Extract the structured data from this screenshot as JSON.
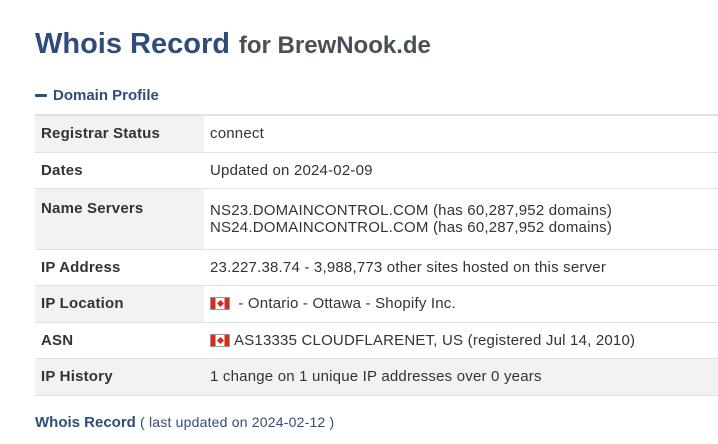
{
  "header": {
    "title": "Whois Record",
    "subtitle": "for BrewNook.de"
  },
  "section": {
    "label": "Domain Profile",
    "icon": "minus-icon"
  },
  "profile": {
    "registrar_status": {
      "label": "Registrar Status",
      "value": "connect"
    },
    "dates": {
      "label": "Dates",
      "value": "Updated on 2024-02-09"
    },
    "name_servers": {
      "label": "Name Servers",
      "values": [
        "NS23.DOMAINCONTROL.COM (has 60,287,952 domains)",
        "NS24.DOMAINCONTROL.COM (has 60,287,952 domains)"
      ]
    },
    "ip_address": {
      "label": "IP Address",
      "value": "23.227.38.74 - 3,988,773 other sites hosted on this server"
    },
    "ip_location": {
      "label": "IP Location",
      "value": " - Ontario - Ottawa - Shopify Inc.",
      "flag": "canada-flag-icon"
    },
    "asn": {
      "label": "ASN",
      "value": "AS13335 CLOUDFLARENET, US (registered Jul 14, 2010)",
      "flag": "canada-flag-icon"
    },
    "ip_history": {
      "label": "IP History",
      "value": "1 change on 1 unique IP addresses over 0 years"
    }
  },
  "footer": {
    "link": "Whois Record",
    "note": "( last updated on 2024-02-12 )"
  },
  "colors": {
    "brand": "#2f4d7a",
    "row_shade": "#f2f2f2",
    "border": "#dee2e6"
  }
}
